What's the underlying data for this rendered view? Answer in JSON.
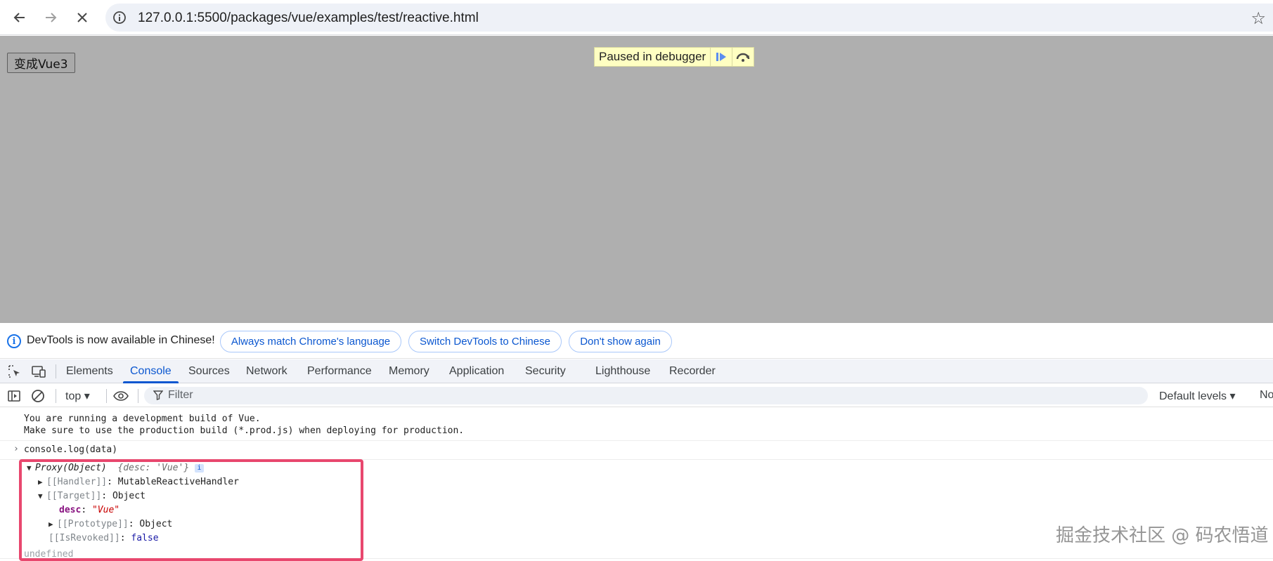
{
  "browser": {
    "url": "127.0.0.1:5500/packages/vue/examples/test/reactive.html",
    "back_icon": "arrow-left-icon",
    "forward_icon": "arrow-right-icon",
    "stop_icon": "close-icon",
    "site_info_icon": "info-icon",
    "bookmark_icon": "star-icon"
  },
  "page": {
    "button_label": "变成Vue3",
    "debugger_text": "Paused in debugger",
    "resume_icon": "resume-icon",
    "step_over_icon": "step-over-icon"
  },
  "infobar": {
    "message": "DevTools is now available in Chinese!",
    "match_language_label": "Always match Chrome's language",
    "switch_label": "Switch DevTools to Chinese",
    "dismiss_label": "Don't show again"
  },
  "devtools": {
    "tabs": [
      "Elements",
      "Console",
      "Sources",
      "Network",
      "Performance",
      "Memory",
      "Application",
      "Security",
      "Lighthouse",
      "Recorder"
    ],
    "active_tab": "Console",
    "context": "top ▾",
    "filter_placeholder": "Filter",
    "levels_label": "Default levels ▾",
    "truncated_label": "No"
  },
  "console": {
    "warning_line1": "You are running a development build of Vue.",
    "warning_line2": "Make sure to use the production build (*.prod.js) when deploying for production.",
    "command": "console.log(data)",
    "proxy_label": "Proxy(Object)",
    "proxy_preview": "{desc: 'Vue'}",
    "handler_key": "[[Handler]]",
    "handler_value": "MutableReactiveHandler",
    "target_key": "[[Target]]",
    "target_value": "Object",
    "desc_key": "desc",
    "desc_value": "\"Vue\"",
    "prototype_key": "[[Prototype]]",
    "prototype_value": "Object",
    "revoked_key": "[[IsRevoked]]",
    "revoked_value": "false",
    "result": "undefined"
  },
  "watermark": "掘金技术社区 @ 码农悟道",
  "colors": {
    "accent": "#0b57d0",
    "highlight_border": "#e8476e",
    "overlay": "#afafaf",
    "debugger_bg": "#ffffc2"
  }
}
